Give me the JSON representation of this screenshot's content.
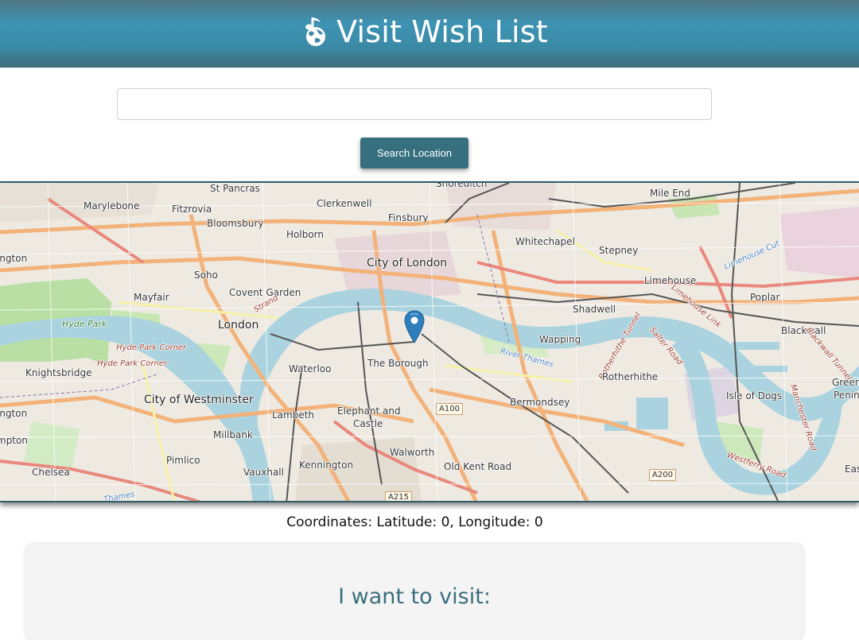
{
  "header": {
    "title": "Visit Wish List",
    "logo_icon": "globe-music-note-icon",
    "colors": {
      "top": "#4f7684",
      "mid": "#3d93b3",
      "bottom": "#3f6d7c"
    }
  },
  "search": {
    "value": "",
    "placeholder": "",
    "button_label": "Search Location",
    "button_color": "#36707e"
  },
  "map": {
    "marker_icon": "map-pin-icon",
    "marker_color": "#2e7ebd",
    "labels": {
      "st_pancras": "St Pancras",
      "shoreditch": "Shoreditch",
      "mile_end": "Mile End",
      "marylebone": "Marylebone",
      "fitzrovia": "Fitzrovia",
      "clerkenwell": "Clerkenwell",
      "finsbury": "Finsbury",
      "bloomsbury": "Bloomsbury",
      "whitechapel": "Whitechapel",
      "holborn": "Holborn",
      "stepney": "Stepney",
      "ington": "ington",
      "soho": "Soho",
      "city_of_london": "City of London",
      "limehouse_cut": "Limehouse Cut",
      "limehouse": "Limehouse",
      "mayfair": "Mayfair",
      "covent_garden": "Covent Garden",
      "strand": "Strand",
      "poplar": "Poplar",
      "shadwell": "Shadwell",
      "limehouse_link": "Limehouse Link",
      "hyde_park": "Hyde Park",
      "london": "London",
      "blackwall": "Blackwall",
      "wapping": "Wapping",
      "rotherhithe_tunnel": "Rotherhithe Tunnel",
      "salter_road": "Salter Road",
      "hyde_park_corner": "Hyde Park Corner",
      "river_thames": "River Thames",
      "blackwall_tunnel": "Blackwall Tunnel",
      "knightsbridge": "Knightsbridge",
      "waterloo": "Waterloo",
      "the_borough": "The Borough",
      "rotherhithe": "Rotherhithe",
      "green": "Green",
      "penin": "Penin",
      "city_of_westminster": "City of Westminster",
      "isle_of_dogs": "Isle of Dogs",
      "bermondsey": "Bermondsey",
      "lambeth": "Lambeth",
      "elephant_and": "Elephant and",
      "castle": "Castle",
      "a100": "A100",
      "manchester_road": "Manchester Road",
      "millbank": "Millbank",
      "mpton": "mpton",
      "walworth": "Walworth",
      "pimlico": "Pimlico",
      "kennington": "Kennington",
      "old_kent_road": "Old Kent Road",
      "westferry_road": "Westferry Road",
      "a200": "A200",
      "chelsea": "Chelsea",
      "vauxhall": "Vauxhall",
      "thames": "Thames",
      "a215": "A215",
      "eas": "Eas"
    }
  },
  "coordinates": {
    "text": "Coordinates: Latitude: 0, Longitude: 0"
  },
  "wish_list": {
    "heading": "I want to visit:"
  }
}
